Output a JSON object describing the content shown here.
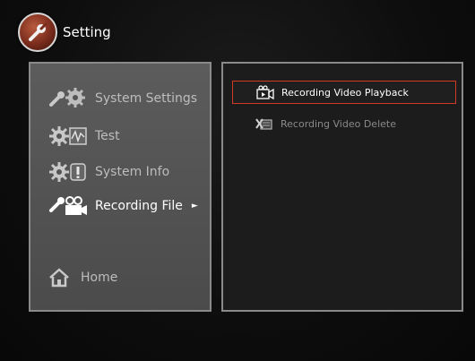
{
  "header": {
    "title": "Setting",
    "icon": "wrench-icon"
  },
  "menu": {
    "items": [
      {
        "label": "System Settings",
        "icon": "wrench-gear-icon"
      },
      {
        "label": "Test",
        "icon": "gear-chart-icon"
      },
      {
        "label": "System Info",
        "icon": "gear-info-icon"
      },
      {
        "label": "Recording File",
        "icon": "wrench-camera-icon",
        "arrow": "►"
      }
    ],
    "home": {
      "label": "Home",
      "icon": "home-icon"
    }
  },
  "submenu": {
    "items": [
      {
        "label": "Recording Video Playback",
        "icon": "video-playback-icon"
      },
      {
        "label": "Recording Video Delete",
        "icon": "video-delete-icon"
      }
    ]
  },
  "colors": {
    "selection_border": "#d23a22",
    "panel": "#555555",
    "background": "#0c0c0c"
  }
}
